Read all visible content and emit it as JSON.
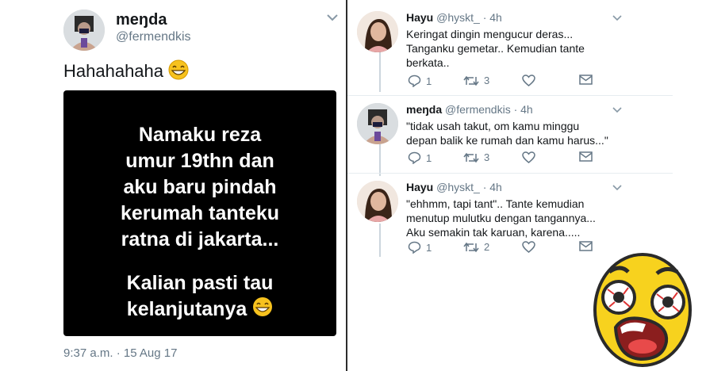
{
  "main_tweet": {
    "display_name": "meŋda",
    "handle": "@fermendkis",
    "text": "Hahahahaha",
    "media_lines": [
      "Namaku reza",
      "umur 19thn dan",
      "aku baru pindah",
      "kerumah tanteku",
      "ratna di jakarta..."
    ],
    "media_lines_2": [
      "Kalian pasti tau",
      "kelanjutanya"
    ],
    "timestamp": "9:37 a.m. · 15 Aug 17"
  },
  "replies": [
    {
      "name": "Hayu",
      "handle": "@hyskt_",
      "time": "· 4h",
      "text": [
        "Keringat dingin mengucur deras...",
        "Tanganku gemetar.. Kemudian tante",
        "berkata.."
      ],
      "reply_count": "1",
      "retweet_count": "3"
    },
    {
      "name": "meŋda",
      "handle": "@fermendkis",
      "time": "· 4h",
      "text": [
        "\"tidak usah takut, om kamu minggu",
        "depan balik ke rumah dan kamu harus...\""
      ],
      "reply_count": "1",
      "retweet_count": "3"
    },
    {
      "name": "Hayu",
      "handle": "@hyskt_",
      "time": "· 4h",
      "text": [
        "\"ehhmm, tapi tant\".. Tante kemudian",
        "menutup mulutku dengan tangannya...",
        "Aku semakin tak karuan, karena....."
      ],
      "reply_count": "1",
      "retweet_count": "2"
    }
  ],
  "colors": {
    "text": "#14171a",
    "muted": "#657786",
    "rail": "#ccd6dd",
    "emoji_yellow": "#f7d21e"
  },
  "icons": [
    "chevron-down-icon",
    "reply-icon",
    "retweet-icon",
    "like-icon",
    "direct-message-icon",
    "grinning-emoji-icon",
    "shocked-face-icon"
  ]
}
